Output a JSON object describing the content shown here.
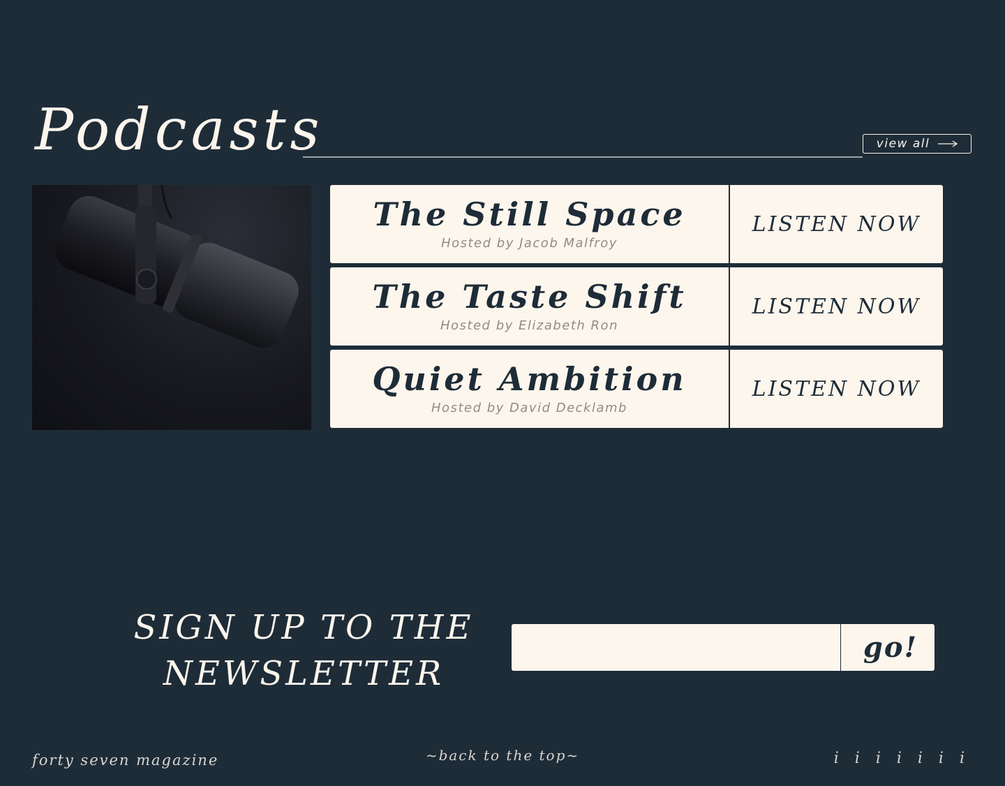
{
  "section": {
    "title": "Podcasts",
    "view_all_label": "view all",
    "view_all_icon": "arrow-right-icon"
  },
  "image": {
    "subject": "microphone-icon"
  },
  "podcasts": [
    {
      "name": "The Still Space",
      "host": "Hosted by Jacob Malfroy",
      "action": "LISTEN NOW"
    },
    {
      "name": "The Taste Shift",
      "host": "Hosted by Elizabeth Ron",
      "action": "LISTEN NOW"
    },
    {
      "name": "Quiet Ambition",
      "host": "Hosted by David Decklamb",
      "action": "LISTEN NOW"
    }
  ],
  "newsletter": {
    "heading_line1": "SIGN UP TO THE",
    "heading_line2": "NEWSLETTER",
    "input_value": "",
    "button_label": "go!"
  },
  "footer": {
    "brand": "forty seven magazine",
    "back_to_top": "~back to the top~",
    "marks": "i i i i i i i"
  },
  "colors": {
    "background": "#1e2c38",
    "card": "#fdf6ed",
    "text_light": "#fbf5ec",
    "text_dark": "#1e2c38",
    "host_text": "#8e8c88"
  }
}
